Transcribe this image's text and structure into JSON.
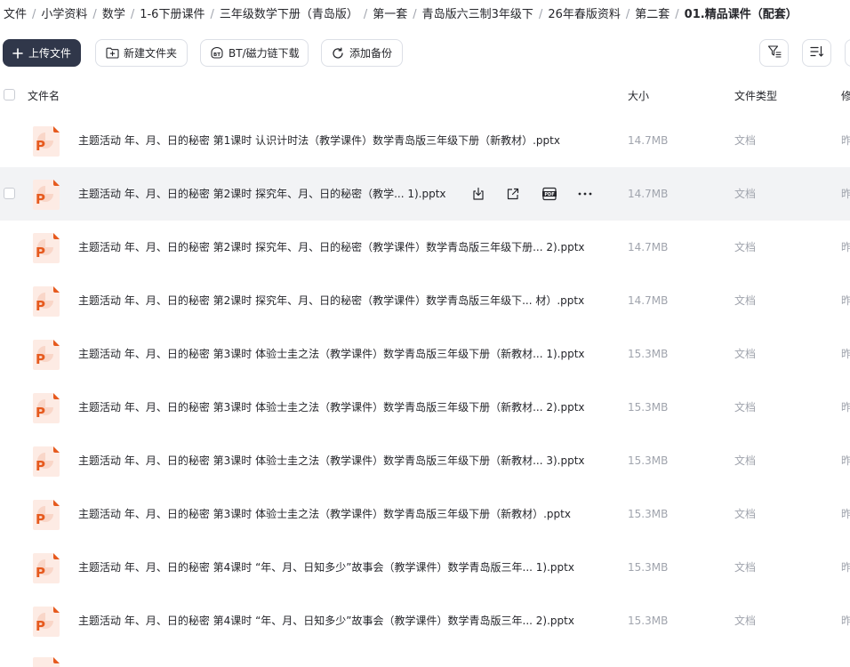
{
  "breadcrumb": {
    "items": [
      "文件",
      "小学资料",
      "数学",
      "1-6下册课件",
      "三年级数学下册（青岛版）",
      "第一套",
      "青岛版六三制3年级下",
      "26年春版资料",
      "第二套",
      "01.精品课件（配套）"
    ],
    "separator": "/"
  },
  "toolbar": {
    "upload_label": "上传文件",
    "new_folder_label": "新建文件夹",
    "bt_label": "BT/磁力链下载",
    "backup_label": "添加备份"
  },
  "table": {
    "headers": {
      "name": "文件名",
      "size": "大小",
      "type": "文件类型",
      "modified": "修"
    },
    "rows": [
      {
        "name": "主题活动 年、月、日的秘密 第1课时 认识计时法（教学课件）数学青岛版三年级下册（新教材）.pptx",
        "size": "14.7MB",
        "type": "文档",
        "modified": "昨"
      },
      {
        "name": "主题活动 年、月、日的秘密 第2课时  探究年、月、日的秘密（教学... 1).pptx",
        "size": "14.7MB",
        "type": "文档",
        "modified": "昨",
        "hovered": true
      },
      {
        "name": "主题活动 年、月、日的秘密 第2课时  探究年、月、日的秘密（教学课件）数学青岛版三年级下册... 2).pptx",
        "size": "14.7MB",
        "type": "文档",
        "modified": "昨"
      },
      {
        "name": "主题活动 年、月、日的秘密 第2课时  探究年、月、日的秘密（教学课件）数学青岛版三年级下... 材）.pptx",
        "size": "14.7MB",
        "type": "文档",
        "modified": "昨"
      },
      {
        "name": "主题活动 年、月、日的秘密 第3课时  体验士圭之法（教学课件）数学青岛版三年级下册（新教材... 1).pptx",
        "size": "15.3MB",
        "type": "文档",
        "modified": "昨"
      },
      {
        "name": "主题活动 年、月、日的秘密 第3课时  体验士圭之法（教学课件）数学青岛版三年级下册（新教材... 2).pptx",
        "size": "15.3MB",
        "type": "文档",
        "modified": "昨"
      },
      {
        "name": "主题活动 年、月、日的秘密 第3课时  体验士圭之法（教学课件）数学青岛版三年级下册（新教材... 3).pptx",
        "size": "15.3MB",
        "type": "文档",
        "modified": "昨"
      },
      {
        "name": "主题活动 年、月、日的秘密 第3课时  体验士圭之法（教学课件）数学青岛版三年级下册（新教材）.pptx",
        "size": "15.3MB",
        "type": "文档",
        "modified": "昨"
      },
      {
        "name": "主题活动 年、月、日的秘密 第4课时  “年、月、日知多少”故事会（教学课件）数学青岛版三年... 1).pptx",
        "size": "15.3MB",
        "type": "文档",
        "modified": "昨"
      },
      {
        "name": "主题活动 年、月、日的秘密 第4课时  “年、月、日知多少”故事会（教学课件）数学青岛版三年... 2).pptx",
        "size": "15.3MB",
        "type": "文档",
        "modified": "昨"
      }
    ]
  },
  "icons": {
    "upload": "plus-icon",
    "new_folder": "folder-plus-icon",
    "bt": "bt-icon",
    "backup": "refresh-icon",
    "filter": "filter-icon",
    "sort": "sort-icon",
    "file": "pptx-file-icon",
    "row_download": "download-icon",
    "row_share": "share-icon",
    "row_pdf": "pdf-icon",
    "row_more": "more-icon"
  },
  "colors": {
    "primary_button": "#30374a",
    "pptx_orange": "#e65a1e",
    "muted_text": "#a0a4ad",
    "hover_row": "#f2f3f5"
  }
}
